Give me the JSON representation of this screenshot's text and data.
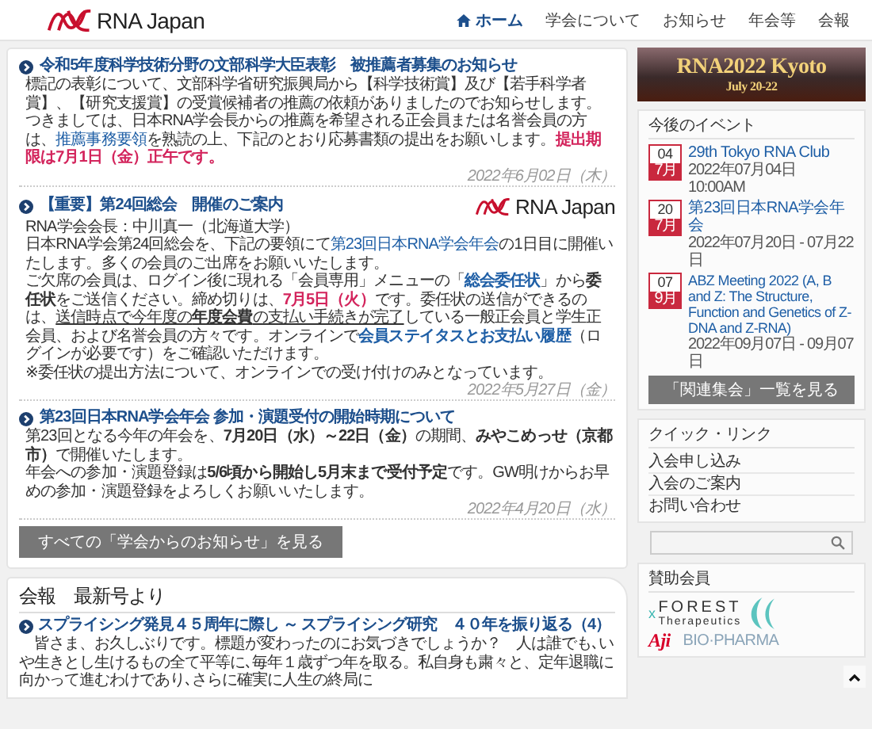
{
  "header": {
    "logo": {
      "text": "RNA Japan"
    },
    "nav": [
      {
        "label": "ホーム",
        "selected": true
      },
      {
        "label": "学会について",
        "selected": false
      },
      {
        "label": "お知らせ",
        "selected": false
      },
      {
        "label": "年会等",
        "selected": false
      },
      {
        "label": "会報",
        "selected": false
      }
    ]
  },
  "news": {
    "items": [
      {
        "title": "令和5年度科学技術分野の文部科学大臣表彰　被推薦者募集のお知らせ",
        "paragraphs": [
          [
            {
              "kind": "text",
              "text": "標記の表彰について、文部科学省研究振興局から【科学技術賞】及び【若手科学者賞】、【研究支援賞】の受賞候補者の推薦の依頼がありましたのでお知らせします。つきましては、日本RNA学会長からの推薦を希望される正会員または名誉会員の方は、"
            },
            {
              "kind": "link",
              "text": "推薦事務要領"
            },
            {
              "kind": "text",
              "text": "を熟読の上、下記のとおり応募書類の提出をお願いします。"
            },
            {
              "kind": "alert",
              "text": "提出期限は7月1日（金）正午です。"
            }
          ]
        ],
        "date": "2022年6月02日（木）"
      },
      {
        "title": "【重要】第24回総会　開催のご案内",
        "logo": {
          "text": "RNA Japan"
        },
        "paragraphs": [
          [
            {
              "kind": "text",
              "text": "RNA学会会長：中川真一（北海道大学）"
            }
          ],
          [
            {
              "kind": "text",
              "text": "日本RNA学会第24回総会を、下記の要領にて"
            },
            {
              "kind": "link",
              "text": "第23回日本RNA学会年会"
            },
            {
              "kind": "text",
              "text": "の1日目に開催いたします。多くの会員のご出席をお願いいたします。"
            }
          ],
          [
            {
              "kind": "text",
              "text": "ご欠席の会員は、ログイン後に現れる「会員専用」メニューの「"
            },
            {
              "kind": "bold-link",
              "text": "総会委任状"
            },
            {
              "kind": "text",
              "text": "」から"
            },
            {
              "kind": "bold",
              "text": "委任状"
            },
            {
              "kind": "text",
              "text": "をご送信ください。締め切りは、"
            },
            {
              "kind": "alert",
              "text": "7月5日（火）"
            },
            {
              "kind": "text",
              "text": "です。委任状の送信ができるのは、"
            },
            {
              "kind": "underline",
              "text": "送信時点で今年度の**年度会費**の支払い手続きが完了"
            },
            {
              "kind": "text",
              "text": "している一般正会員と学生正会員、および名誉会員の方々です。オンラインで"
            },
            {
              "kind": "bold-link",
              "text": "会員ステイタスとお支払い履歴"
            },
            {
              "kind": "text",
              "text": "（ログインが必要です）をご確認いただけます。"
            }
          ],
          [
            {
              "kind": "text",
              "text": "※委任状の提出方法について、オンラインでの受け付けのみとなっています。"
            }
          ]
        ],
        "date": "2022年5月27日（金）"
      },
      {
        "title": "第23回日本RNA学会年会 参加・演題受付の開始時期について",
        "paragraphs": [
          [
            {
              "kind": "text",
              "text": "第23回となる今年の年会を、"
            },
            {
              "kind": "bold",
              "text": "7月20日（水）～22日（金）"
            },
            {
              "kind": "text",
              "text": "の期間、"
            },
            {
              "kind": "bold",
              "text": "みやこめっせ（京都市）"
            },
            {
              "kind": "text",
              "text": "で開催いたします。"
            }
          ],
          [
            {
              "kind": "text",
              "text": "年会への参加・演題登録は"
            },
            {
              "kind": "bold",
              "text": "5/6頃から開始し5月末まで受付予定"
            },
            {
              "kind": "text",
              "text": "です。GW明けからお早めの参加・演題登録をよろしくお願いいたします。"
            }
          ]
        ],
        "date": "2022年4月20日（水）"
      }
    ],
    "more_button": "すべての「学会からのお知らせ」を見る"
  },
  "bulletin": {
    "heading": "会報　最新号より",
    "article": {
      "title": "スプライシング発見４５周年に際し ～ スプライシング研究　４０年を振り返る（4）",
      "excerpt": "　皆さま、お久しぶりです。標題が変わったのにお気づきでしょうか？　人は誰でも､いや生きとし生けるもの全て平等に､毎年１歳ずつ年を取る。私自身も粛々と、定年退職に向かって進むわけであり､さらに確実に人生の終局に"
    }
  },
  "sidebar": {
    "banner": {
      "title": "RNA2022 Kyoto",
      "subtitle": "July 20-22"
    },
    "events": {
      "heading": "今後のイベント",
      "items": [
        {
          "day": "04",
          "month": "7月",
          "title": "29th Tokyo RNA Club",
          "when": "2022年07月04日 10:00AM"
        },
        {
          "day": "20",
          "month": "7月",
          "title": "第23回日本RNA学会年会",
          "when": "2022年07月20日 - 07月22日"
        },
        {
          "day": "07",
          "month": "9月",
          "title": "ABZ Meeting 2022 (A, B and Z: The Structure, Function and Genetics of Z-DNA and Z-RNA)",
          "when": "2022年09月07日 - 09月07日"
        }
      ],
      "button": "「関連集会」一覧を見る"
    },
    "quick_links": {
      "heading": "クイック・リンク",
      "items": [
        "入会申し込み",
        "入会のご案内",
        "お問い合わせ"
      ]
    },
    "sponsors": {
      "heading": "賛助会員",
      "items": [
        {
          "kind": "forest",
          "prefix": "x",
          "name": "FOREST",
          "tagline": "Therapeutics"
        },
        {
          "kind": "aji",
          "mark": "Aji",
          "name": "BIO·PHARMA"
        }
      ]
    }
  }
}
